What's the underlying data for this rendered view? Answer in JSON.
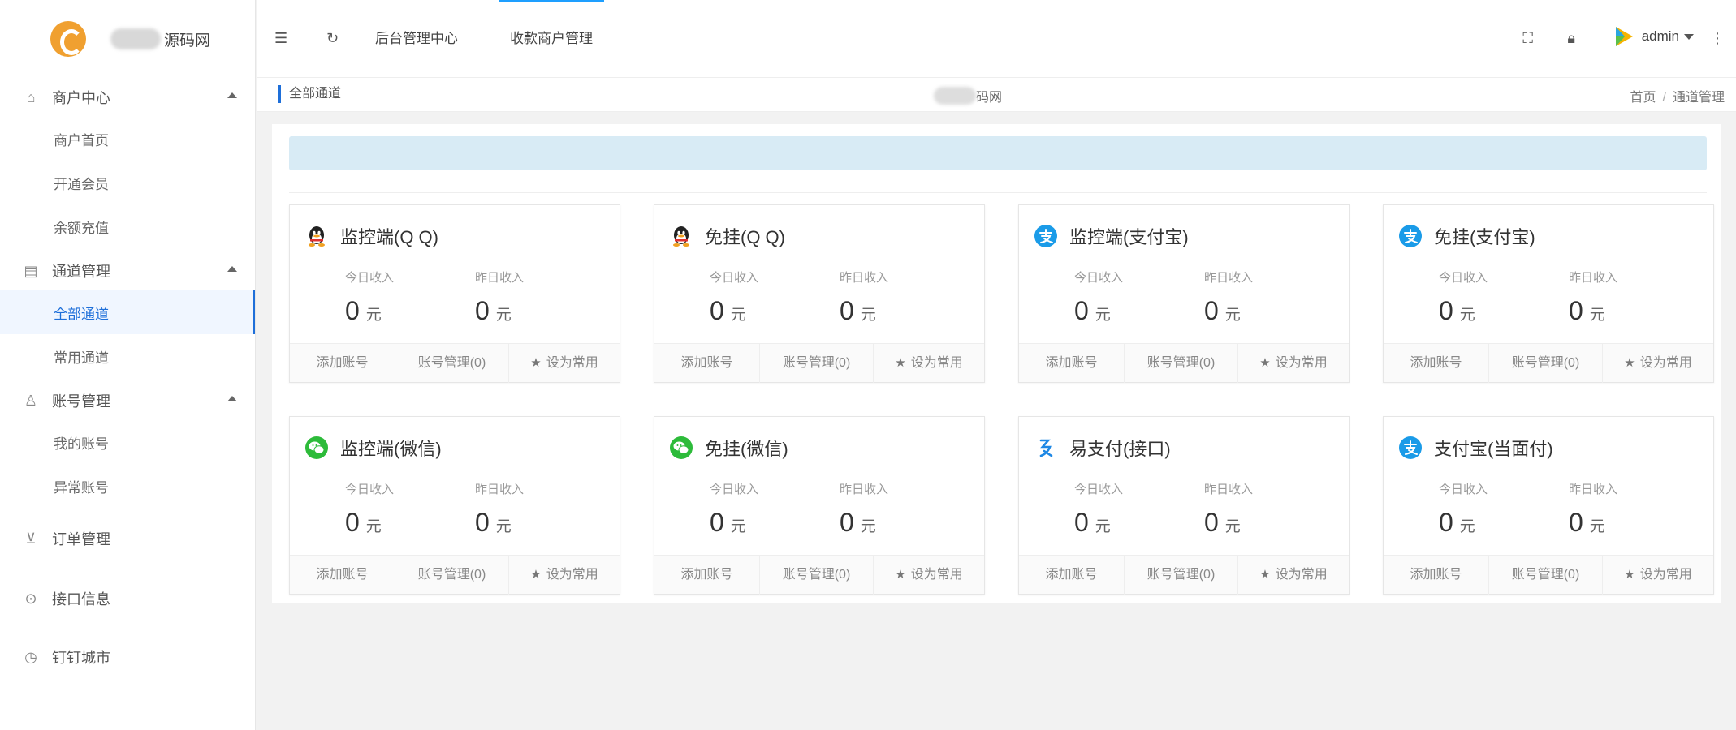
{
  "sidebar": {
    "logo_text": "源码网",
    "groups": [
      {
        "label": "商户中心",
        "icon": "home-icon",
        "items": [
          "商户首页",
          "开通会员",
          "余额充值"
        ]
      },
      {
        "label": "通道管理",
        "icon": "channel-icon",
        "items": [
          "全部通道",
          "常用通道"
        ]
      },
      {
        "label": "账号管理",
        "icon": "user-icon",
        "items": [
          "我的账号",
          "异常账号"
        ]
      },
      {
        "label": "订单管理",
        "icon": "cart-icon",
        "items": []
      },
      {
        "label": "接口信息",
        "icon": "info-icon",
        "items": []
      },
      {
        "label": "钉钉城市",
        "icon": "clock-icon",
        "items": []
      }
    ]
  },
  "header": {
    "tabs": [
      "后台管理中心",
      "收款商户管理"
    ],
    "user": "admin"
  },
  "breadcrumb": {
    "current": "全部通道",
    "center": "码网",
    "home": "首页",
    "sep": "/",
    "page": "通道管理"
  },
  "cards": [
    {
      "title": "监控端(Q Q)",
      "icon": "qq-icon",
      "today_label": "今日收入",
      "yesterday_label": "昨日收入",
      "today": "0",
      "yesterday": "0",
      "unit": "元",
      "add": "添加账号",
      "manage": "账号管理(0)",
      "fav": "设为常用"
    },
    {
      "title": "免挂(Q Q)",
      "icon": "qq-icon",
      "today_label": "今日收入",
      "yesterday_label": "昨日收入",
      "today": "0",
      "yesterday": "0",
      "unit": "元",
      "add": "添加账号",
      "manage": "账号管理(0)",
      "fav": "设为常用"
    },
    {
      "title": "监控端(支付宝)",
      "icon": "alipay-icon",
      "today_label": "今日收入",
      "yesterday_label": "昨日收入",
      "today": "0",
      "yesterday": "0",
      "unit": "元",
      "add": "添加账号",
      "manage": "账号管理(0)",
      "fav": "设为常用"
    },
    {
      "title": "免挂(支付宝)",
      "icon": "alipay-icon",
      "today_label": "今日收入",
      "yesterday_label": "昨日收入",
      "today": "0",
      "yesterday": "0",
      "unit": "元",
      "add": "添加账号",
      "manage": "账号管理(0)",
      "fav": "设为常用"
    },
    {
      "title": "监控端(微信)",
      "icon": "wechat-icon",
      "today_label": "今日收入",
      "yesterday_label": "昨日收入",
      "today": "0",
      "yesterday": "0",
      "unit": "元",
      "add": "添加账号",
      "manage": "账号管理(0)",
      "fav": "设为常用"
    },
    {
      "title": "免挂(微信)",
      "icon": "wechat-icon",
      "today_label": "今日收入",
      "yesterday_label": "昨日收入",
      "today": "0",
      "yesterday": "0",
      "unit": "元",
      "add": "添加账号",
      "manage": "账号管理(0)",
      "fav": "设为常用"
    },
    {
      "title": "易支付(接口)",
      "icon": "epay-icon",
      "today_label": "今日收入",
      "yesterday_label": "昨日收入",
      "today": "0",
      "yesterday": "0",
      "unit": "元",
      "add": "添加账号",
      "manage": "账号管理(0)",
      "fav": "设为常用"
    },
    {
      "title": "支付宝(当面付)",
      "icon": "alipay-icon",
      "today_label": "今日收入",
      "yesterday_label": "昨日收入",
      "today": "0",
      "yesterday": "0",
      "unit": "元",
      "add": "添加账号",
      "manage": "账号管理(0)",
      "fav": "设为常用"
    }
  ],
  "colors": {
    "accent": "#1e6fd9",
    "notice": "#d8ebf5",
    "qq": "#222222",
    "alipay": "#1a9be8",
    "wechat": "#2dbb3a"
  }
}
